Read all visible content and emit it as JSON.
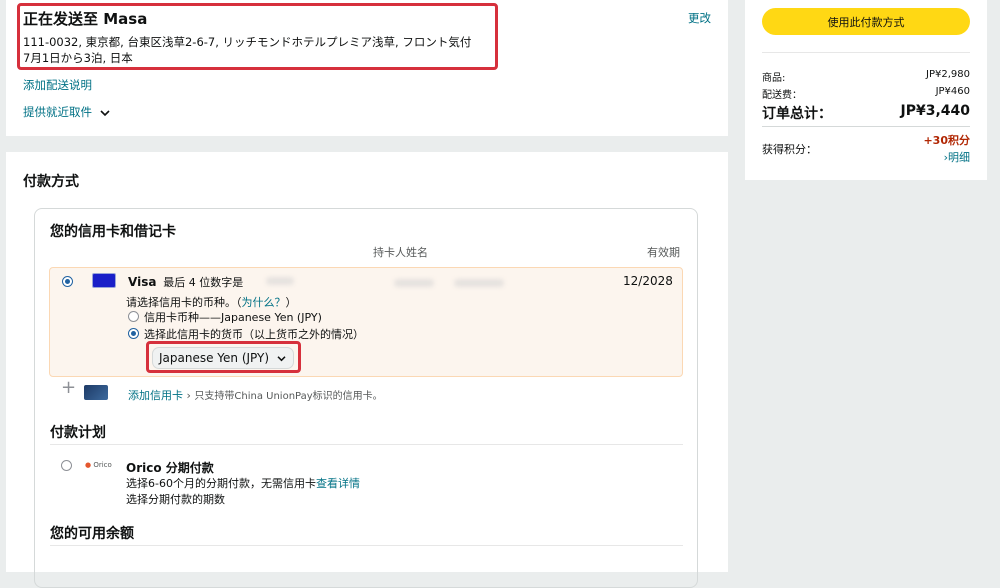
{
  "shipping": {
    "heading": "正在发送至 Masa",
    "address_line1": "111-0032, 東京都, 台東区浅草2-6-7, リッチモンドホテルプレミア浅草, フロント気付",
    "address_line2": "7月1日から3泊, 日本",
    "change_link": "更改",
    "add_instructions": "添加配送说明",
    "pickup_option": "提供就近取件"
  },
  "payment": {
    "title": "付款方式",
    "cards_section_title": "您的信用卡和借记卡",
    "col_cardholder": "持卡人姓名",
    "col_expiry": "有效期",
    "selected_card": {
      "brand": "Visa",
      "last4_label": "最后 4 位数字是",
      "expiry": "12/2028",
      "currency_prompt": "请选择信用卡的币种。",
      "why_link": "为什么？",
      "option_card_currency": "信用卡币种——Japanese Yen (JPY)",
      "option_other_currency": "选择此信用卡的货币（以上货币之外的情况）",
      "currency_select_value": "Japanese Yen (JPY)"
    },
    "add_card_link": "添加信用卡",
    "add_card_note": "只支持带China UnionPay标识的信用卡。",
    "plan_section_title": "付款计划",
    "orico": {
      "logo_text": "Orico",
      "title": "Orico 分期付款",
      "desc_prefix": "选择6-60个月的分期付款，无需信用卡",
      "details_link": "查看详情",
      "desc2": "选择分期付款的期数"
    },
    "balance_section_title": "您的可用余额"
  },
  "summary": {
    "use_payment_button": "使用此付款方式",
    "items_label": "商品:",
    "items_value": "JP¥2,980",
    "shipping_label": "配送费：",
    "shipping_value": "JP¥460",
    "total_label": "订单总计：",
    "total_value": "JP¥3,440",
    "points_label": "获得积分：",
    "points_value": "+30积分",
    "points_details": "明细"
  },
  "colors": {
    "highlight": "#d6303c",
    "link": "#007185",
    "button_yellow": "#ffd814",
    "points_red": "#b12704"
  }
}
